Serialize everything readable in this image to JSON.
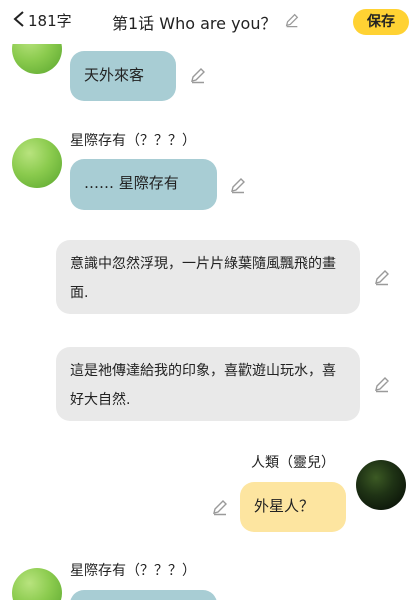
{
  "header": {
    "back_count": "181字",
    "title": "第1话 Who are you？",
    "save_label": "保存"
  },
  "messages": [
    {
      "speaker": "",
      "text": "天外來客"
    },
    {
      "speaker": "星際存有（？？？）",
      "text": "…… 星際存有"
    },
    {
      "speaker": "",
      "text": "意識中忽然浮現，一片片綠葉隨風飄飛的畫面."
    },
    {
      "speaker": "",
      "text": "這是祂傳達給我的印象，喜歡遊山玩水，喜好大自然."
    },
    {
      "speaker": "人類（靈兒）",
      "text": "外星人？"
    },
    {
      "speaker": "星際存有（？？？）",
      "text": ""
    }
  ],
  "colors": {
    "save_bg": "#ffd233",
    "bubble_blue": "#a8cdd4",
    "bubble_gray": "#e9e9e9",
    "bubble_yellow": "#fde5a0"
  },
  "icons": {
    "back": "chevron-left-icon",
    "edit": "pencil-icon"
  }
}
